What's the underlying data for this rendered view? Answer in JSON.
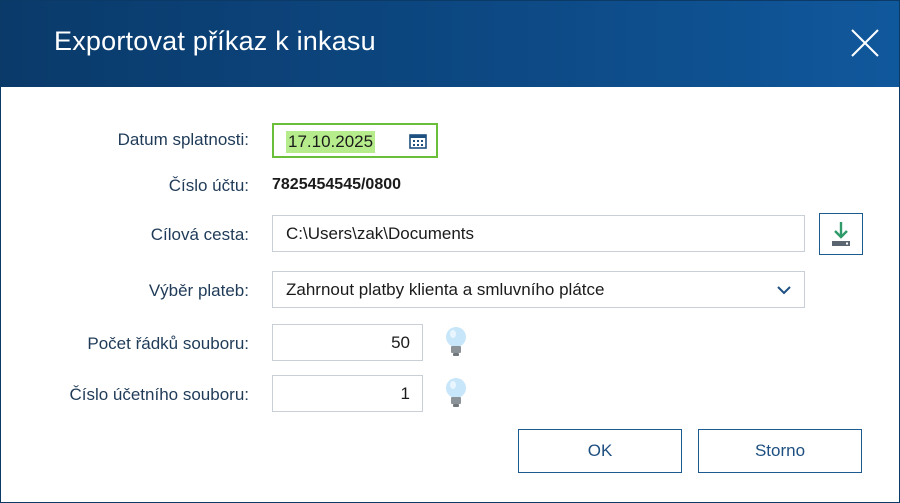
{
  "dialog": {
    "title": "Exportovat příkaz k inkasu",
    "close_icon": "close-icon"
  },
  "form": {
    "due_date": {
      "label": "Datum splatnosti:",
      "value": "17.10.2025",
      "icon": "calendar-icon"
    },
    "account": {
      "label": "Číslo účtu:",
      "value": "7825454545/0800"
    },
    "target_path": {
      "label": "Cílová cesta:",
      "value": "C:\\Users\\zak\\Documents",
      "button_icon": "download-icon"
    },
    "payment_selection": {
      "label": "Výběr plateb:",
      "value": "Zahrnout platby klienta a smluvního plátce"
    },
    "row_count": {
      "label": "Počet řádků souboru:",
      "value": "50",
      "icon": "lightbulb-icon"
    },
    "file_number": {
      "label": "Číslo účetního souboru:",
      "value": "1",
      "icon": "lightbulb-icon"
    }
  },
  "buttons": {
    "ok": "OK",
    "cancel": "Storno"
  },
  "colors": {
    "titlebar": "#0d4a86",
    "focus_border": "#6abf3a",
    "date_highlight": "#b6ec8b",
    "button_border": "#1d5a8e"
  }
}
